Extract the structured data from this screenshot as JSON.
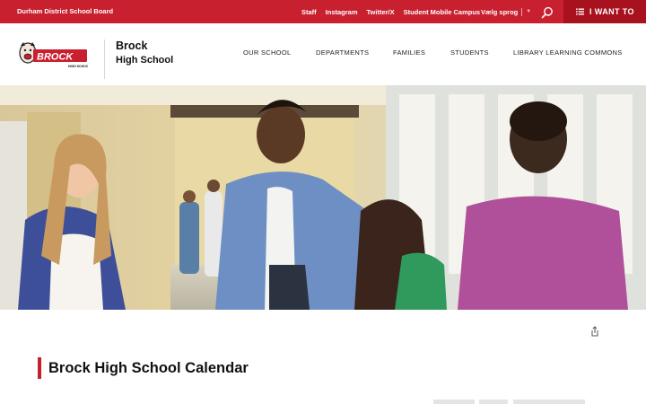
{
  "topbar": {
    "board": "Durham District School Board",
    "links": [
      "Staff",
      "Instagram",
      "Twitter/X",
      "Student Mobile Campus"
    ],
    "language": "Vælg sprog",
    "language_caret": "▼",
    "search_icon": "search-icon",
    "i_want_to": "I WANT TO",
    "i_want_to_icon": "list-icon"
  },
  "header": {
    "logo_text": "BROCK",
    "logo_subtext": "HIGH SCHOOL",
    "school_name": "Brock",
    "school_subtitle": "High School",
    "nav": [
      "OUR SCHOOL",
      "DEPARTMENTS",
      "FAMILIES",
      "STUDENTS",
      "LIBRARY LEARNING COMMONS"
    ]
  },
  "main": {
    "share_icon": "share-icon",
    "calendar_title": "Brock High School Calendar"
  },
  "colors": {
    "brand_red": "#c8202f",
    "dark_red": "#a8121f"
  }
}
